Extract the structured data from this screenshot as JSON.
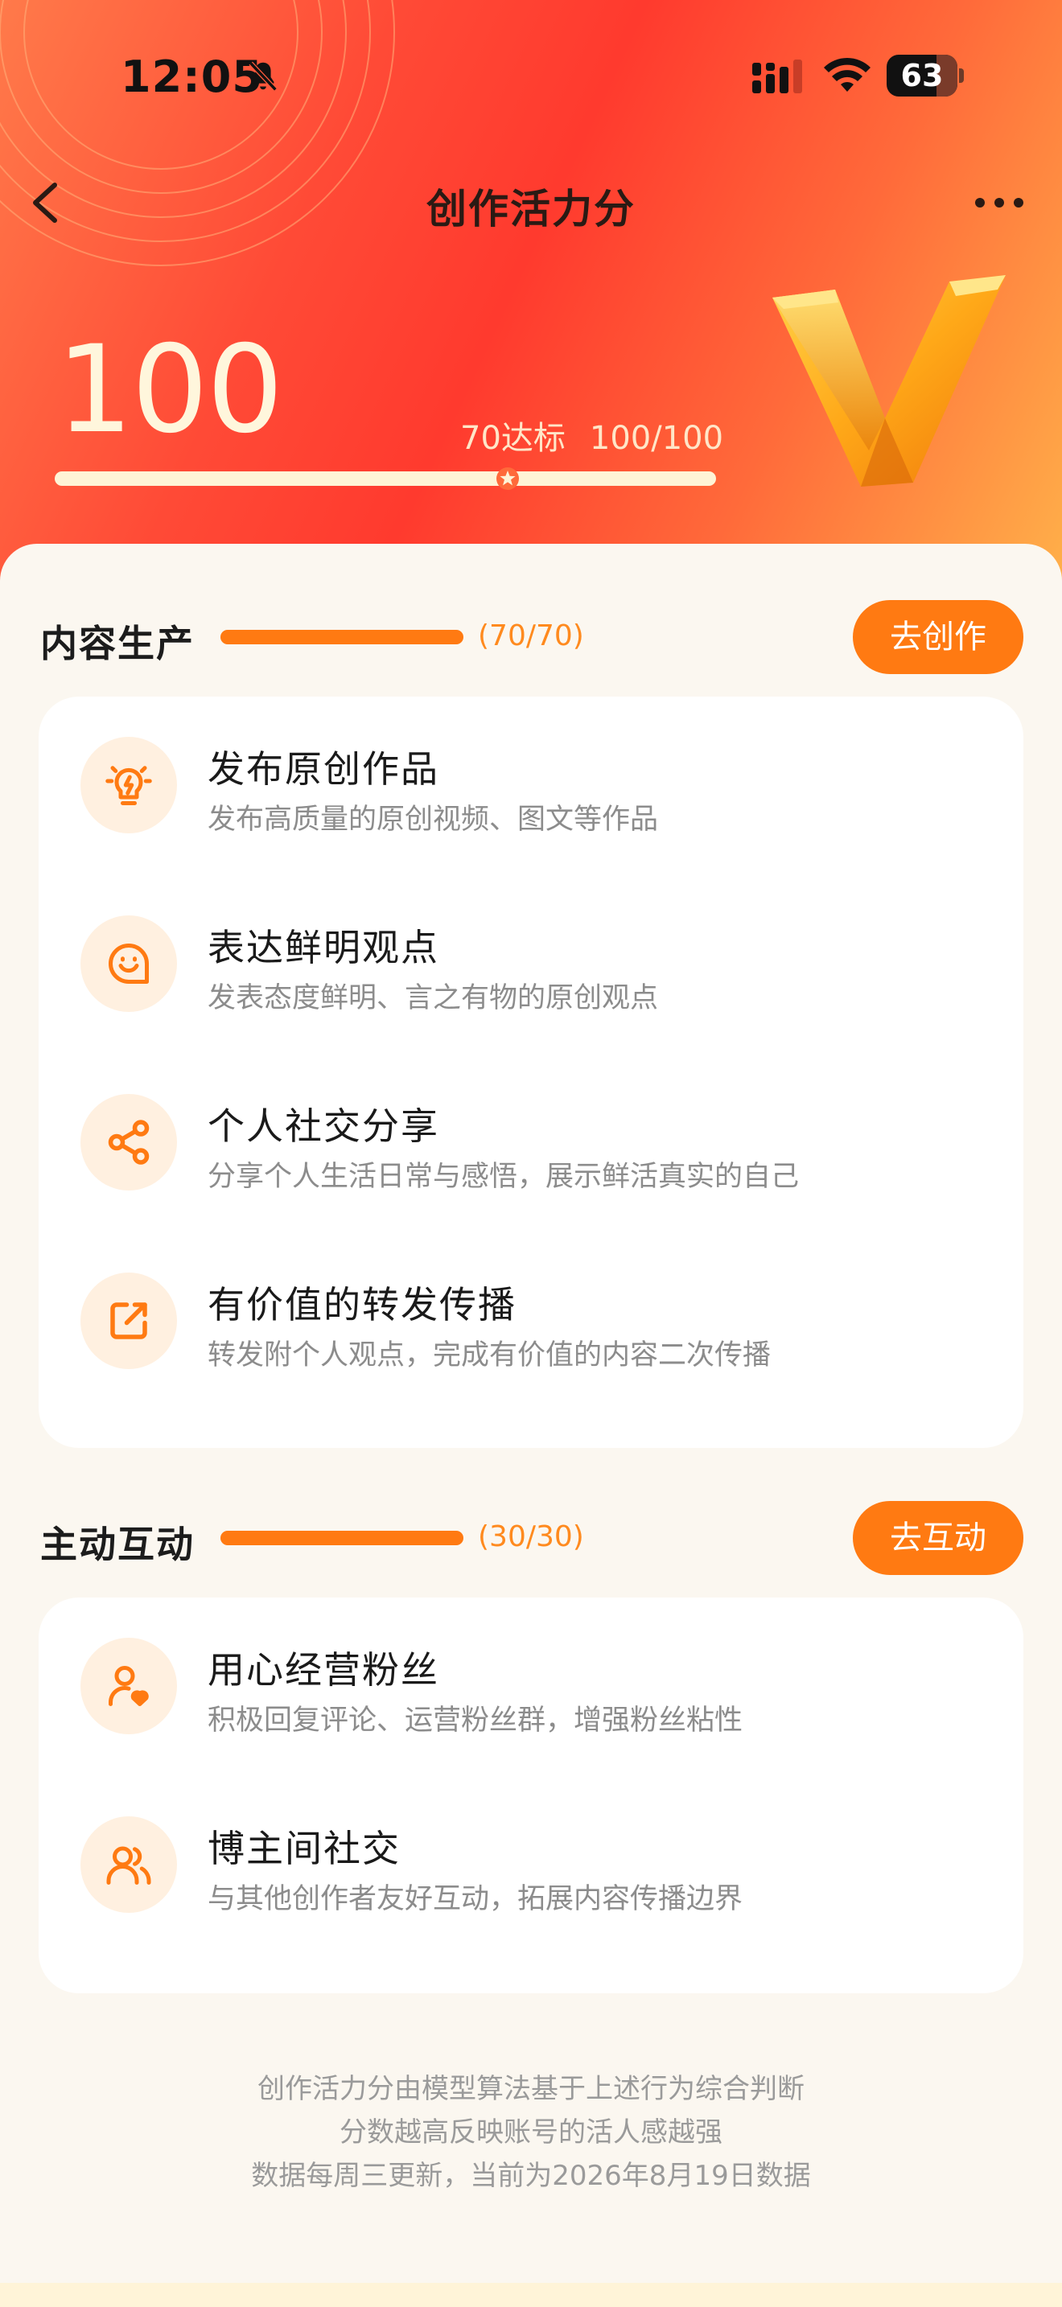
{
  "status_bar": {
    "time": "12:05",
    "battery": "63"
  },
  "header": {
    "title": "创作活力分"
  },
  "score": {
    "value": "100",
    "threshold_label": "70达标",
    "progress_label": "100/100",
    "progress_fraction": 1.0
  },
  "sections": [
    {
      "title": "内容生产",
      "count": "(70/70)",
      "progress_fraction": 1.0,
      "button": "去创作",
      "items": [
        {
          "icon": "lightbulb-icon",
          "title": "发布原创作品",
          "desc": "发布高质量的原创视频、图文等作品"
        },
        {
          "icon": "chat-smile-icon",
          "title": "表达鲜明观点",
          "desc": "发表态度鲜明、言之有物的原创观点"
        },
        {
          "icon": "share-icon",
          "title": "个人社交分享",
          "desc": "分享个人生活日常与感悟，展示鲜活真实的自己"
        },
        {
          "icon": "forward-icon",
          "title": "有价值的转发传播",
          "desc": "转发附个人观点，完成有价值的内容二次传播"
        }
      ]
    },
    {
      "title": "主动互动",
      "count": "(30/30)",
      "progress_fraction": 1.0,
      "button": "去互动",
      "items": [
        {
          "icon": "user-heart-icon",
          "title": "用心经营粉丝",
          "desc": "积极回复评论、运营粉丝群，增强粉丝粘性"
        },
        {
          "icon": "users-icon",
          "title": "博主间社交",
          "desc": "与其他创作者友好互动，拓展内容传播边界"
        }
      ]
    }
  ],
  "footer": {
    "line1": "创作活力分由模型算法基于上述行为综合判断",
    "line2": "分数越高反映账号的活人感越强",
    "line3": "数据每周三更新，当前为2026年8月19日数据"
  },
  "colors": {
    "accent": "#FF7A12",
    "hero_red": "#FF3A2E",
    "hero_orange": "#FFB24A"
  }
}
